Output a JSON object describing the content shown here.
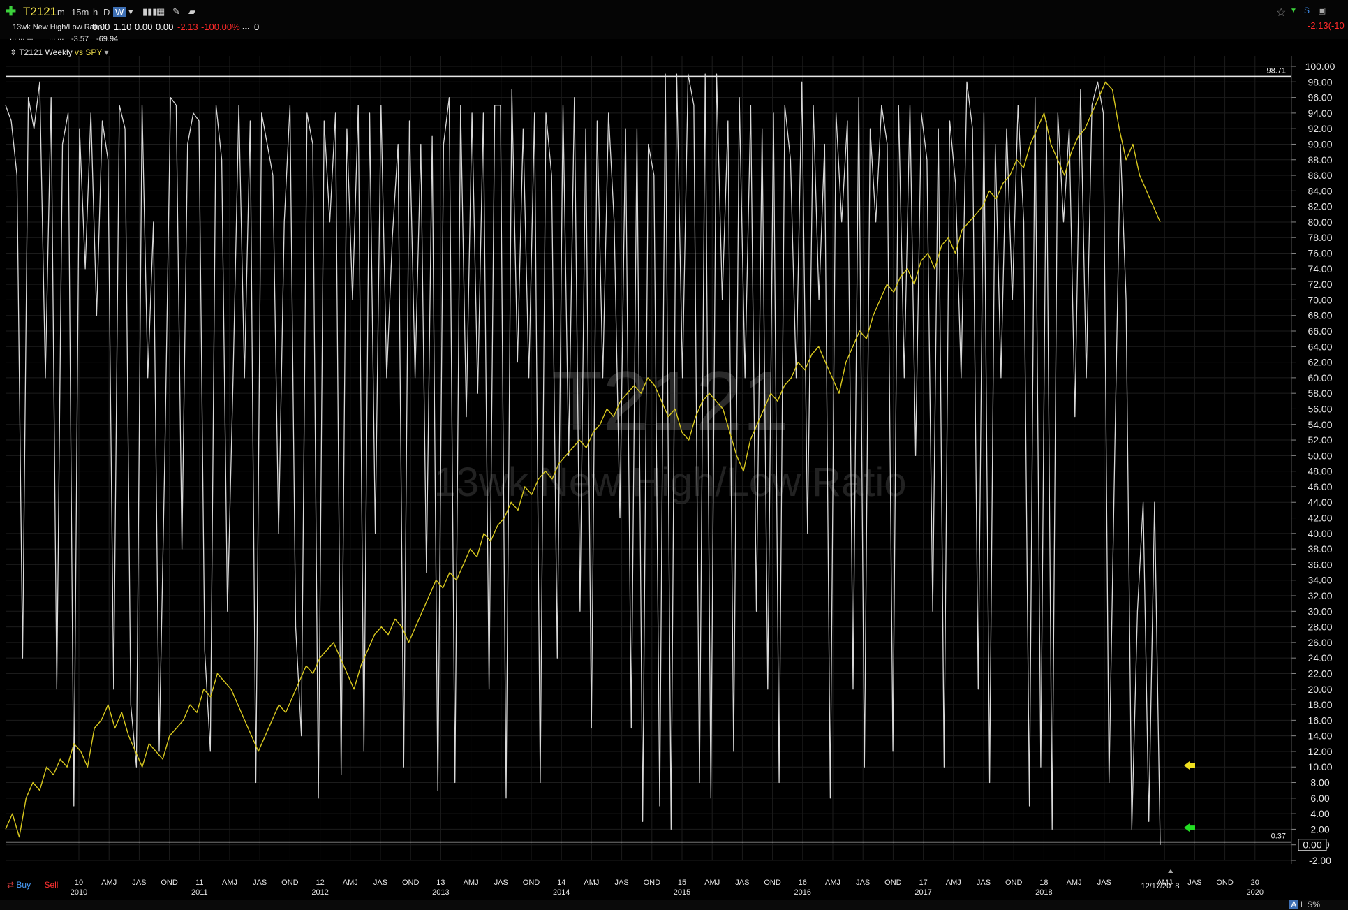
{
  "toolbar": {
    "symbol": "T2121",
    "timeframes": [
      "m",
      "15m",
      "h",
      "D",
      "W"
    ],
    "active_timeframe": "W",
    "indicator_name": "13wk New High/Low Ratio",
    "values": [
      "0.00",
      "1.10",
      "0.00",
      "0.00"
    ],
    "change": "-2.13",
    "change_pct": "-100.00%",
    "volume_label": "...",
    "volume": "0",
    "row2_dots": "... ... ...",
    "row2_dots2": "... ...",
    "row2_val1": "-3.57",
    "row2_val2": "-69.94",
    "right_change": "-2.13(-10"
  },
  "legend": {
    "title": "T2121 Weekly",
    "vs": "vs SPY"
  },
  "watermark": {
    "symbol": "T2121",
    "name": "13wk New High/Low Ratio"
  },
  "footer": {
    "buy_label": "Buy",
    "sell_label": "Sell",
    "date_label": "12/17/2018",
    "right_controls": [
      "A",
      "L",
      "S%"
    ]
  },
  "chart_data": {
    "type": "line",
    "title": "T2121 Weekly",
    "ylim": [
      -2,
      100
    ],
    "y_ticks": [
      "100.00",
      "98.00",
      "96.00",
      "94.00",
      "92.00",
      "90.00",
      "88.00",
      "86.00",
      "84.00",
      "82.00",
      "80.00",
      "78.00",
      "76.00",
      "74.00",
      "72.00",
      "70.00",
      "68.00",
      "66.00",
      "64.00",
      "62.00",
      "60.00",
      "58.00",
      "56.00",
      "54.00",
      "52.00",
      "50.00",
      "48.00",
      "46.00",
      "44.00",
      "42.00",
      "40.00",
      "38.00",
      "36.00",
      "34.00",
      "32.00",
      "30.00",
      "28.00",
      "26.00",
      "24.00",
      "22.00",
      "20.00",
      "18.00",
      "16.00",
      "14.00",
      "12.00",
      "10.00",
      "8.00",
      "6.00",
      "4.00",
      "2.00",
      "0.00",
      "-2.00"
    ],
    "x_ticks": [
      {
        "label": "10",
        "sub": "2010"
      },
      {
        "label": "AMJ",
        "sub": ""
      },
      {
        "label": "JAS",
        "sub": ""
      },
      {
        "label": "OND",
        "sub": ""
      },
      {
        "label": "11",
        "sub": "2011"
      },
      {
        "label": "AMJ",
        "sub": ""
      },
      {
        "label": "JAS",
        "sub": ""
      },
      {
        "label": "OND",
        "sub": ""
      },
      {
        "label": "12",
        "sub": "2012"
      },
      {
        "label": "AMJ",
        "sub": ""
      },
      {
        "label": "JAS",
        "sub": ""
      },
      {
        "label": "OND",
        "sub": ""
      },
      {
        "label": "13",
        "sub": "2013"
      },
      {
        "label": "AMJ",
        "sub": ""
      },
      {
        "label": "JAS",
        "sub": ""
      },
      {
        "label": "OND",
        "sub": ""
      },
      {
        "label": "14",
        "sub": "2014"
      },
      {
        "label": "AMJ",
        "sub": ""
      },
      {
        "label": "JAS",
        "sub": ""
      },
      {
        "label": "OND",
        "sub": ""
      },
      {
        "label": "15",
        "sub": "2015"
      },
      {
        "label": "AMJ",
        "sub": ""
      },
      {
        "label": "JAS",
        "sub": ""
      },
      {
        "label": "OND",
        "sub": ""
      },
      {
        "label": "16",
        "sub": "2016"
      },
      {
        "label": "AMJ",
        "sub": ""
      },
      {
        "label": "JAS",
        "sub": ""
      },
      {
        "label": "OND",
        "sub": ""
      },
      {
        "label": "17",
        "sub": "2017"
      },
      {
        "label": "AMJ",
        "sub": ""
      },
      {
        "label": "JAS",
        "sub": ""
      },
      {
        "label": "OND",
        "sub": ""
      },
      {
        "label": "18",
        "sub": "2018"
      },
      {
        "label": "AMJ",
        "sub": ""
      },
      {
        "label": "JAS",
        "sub": ""
      },
      {
        "label": "AMJ",
        "sub": ""
      },
      {
        "label": "JAS",
        "sub": ""
      },
      {
        "label": "OND",
        "sub": ""
      },
      {
        "label": "20",
        "sub": "2020"
      }
    ],
    "hlines": [
      {
        "label": "98.71",
        "value": 98.71
      },
      {
        "label": "0.37",
        "value": 0.37
      }
    ],
    "last_value_label": "0.00",
    "series": [
      {
        "name": "T2121",
        "color": "#d8d8d8",
        "values": [
          95,
          93,
          86,
          24,
          96,
          92,
          98,
          60,
          96,
          20,
          90,
          94,
          5,
          92,
          74,
          94,
          68,
          93,
          88,
          20,
          95,
          92,
          18,
          10,
          95,
          60,
          80,
          12,
          50,
          96,
          95,
          38,
          90,
          94,
          93,
          25,
          12,
          95,
          88,
          30,
          60,
          95,
          60,
          93,
          8,
          94,
          90,
          86,
          40,
          80,
          95,
          28,
          14,
          94,
          90,
          6,
          93,
          80,
          94,
          9,
          92,
          70,
          95,
          12,
          94,
          40,
          95,
          60,
          78,
          90,
          10,
          93,
          60,
          90,
          35,
          91,
          7,
          90,
          96,
          8,
          95,
          55,
          94,
          58,
          94,
          20,
          95,
          95,
          6,
          97,
          62,
          92,
          60,
          94,
          8,
          94,
          86,
          24,
          95,
          50,
          96,
          30,
          92,
          15,
          93,
          60,
          94,
          80,
          42,
          92,
          15,
          92,
          3,
          90,
          86,
          5,
          99,
          2,
          99,
          60,
          99,
          95,
          8,
          99,
          6,
          99,
          70,
          93,
          12,
          96,
          60,
          95,
          30,
          92,
          20,
          94,
          8,
          95,
          88,
          60,
          98,
          40,
          95,
          70,
          90,
          6,
          94,
          80,
          93,
          20,
          96,
          10,
          92,
          80,
          95,
          90,
          12,
          95,
          60,
          95,
          50,
          94,
          88,
          30,
          92,
          10,
          93,
          85,
          60,
          98,
          92,
          20,
          94,
          8,
          90,
          60,
          92,
          70,
          95,
          80,
          5,
          96,
          10,
          93,
          2,
          94,
          80,
          92,
          55,
          97,
          60,
          95,
          98,
          94,
          8,
          50,
          90,
          70,
          2,
          30,
          44,
          3,
          44,
          0
        ]
      },
      {
        "name": "SPY",
        "color": "#d8c81e",
        "values": [
          2,
          4,
          1,
          6,
          8,
          7,
          10,
          9,
          11,
          10,
          13,
          12,
          10,
          15,
          16,
          18,
          15,
          17,
          14,
          12,
          10,
          13,
          12,
          11,
          14,
          15,
          16,
          18,
          17,
          20,
          19,
          22,
          21,
          20,
          18,
          16,
          14,
          12,
          14,
          16,
          18,
          17,
          19,
          21,
          23,
          22,
          24,
          25,
          26,
          24,
          22,
          20,
          23,
          25,
          27,
          28,
          27,
          29,
          28,
          26,
          28,
          30,
          32,
          34,
          33,
          35,
          34,
          36,
          38,
          37,
          40,
          39,
          41,
          42,
          44,
          43,
          46,
          45,
          47,
          48,
          47,
          49,
          50,
          51,
          52,
          51,
          53,
          54,
          56,
          55,
          57,
          58,
          59,
          58,
          60,
          59,
          57,
          55,
          56,
          53,
          52,
          55,
          57,
          58,
          57,
          56,
          53,
          50,
          48,
          52,
          54,
          56,
          58,
          57,
          59,
          60,
          62,
          61,
          63,
          64,
          62,
          60,
          58,
          62,
          64,
          66,
          65,
          68,
          70,
          72,
          71,
          73,
          74,
          72,
          75,
          76,
          74,
          77,
          78,
          76,
          79,
          80,
          81,
          82,
          84,
          83,
          85,
          86,
          88,
          87,
          90,
          92,
          94,
          90,
          88,
          86,
          89,
          91,
          92,
          94,
          96,
          98,
          97,
          92,
          88,
          90,
          86,
          84,
          82,
          80
        ]
      }
    ],
    "grid": true,
    "legend": "top-left"
  }
}
